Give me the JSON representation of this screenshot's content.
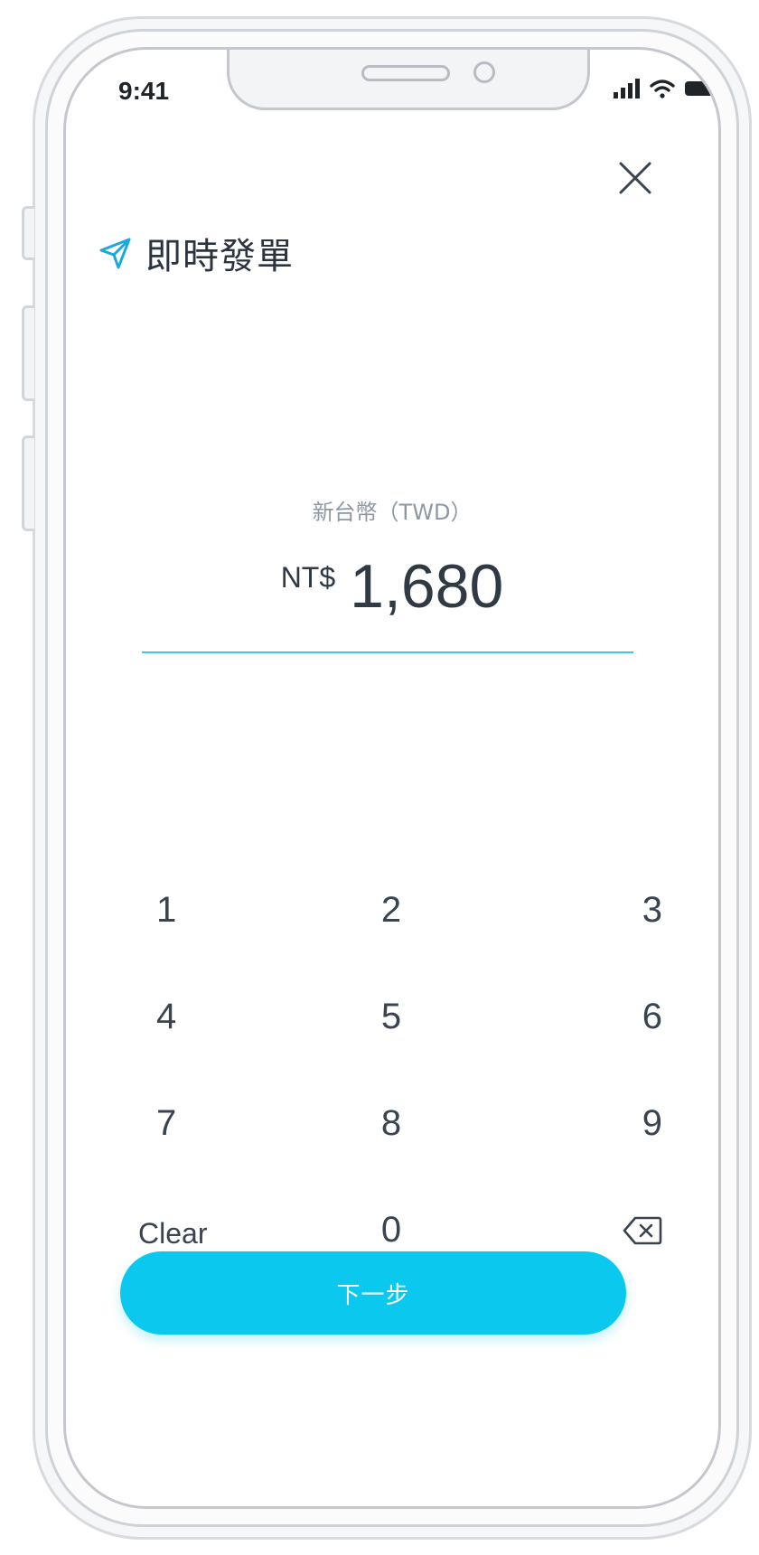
{
  "status_bar": {
    "time": "9:41",
    "signal_icon": "cellular-signal-icon",
    "wifi_icon": "wifi-icon",
    "battery_icon": "battery-icon"
  },
  "header": {
    "close_icon": "close-icon",
    "title_icon": "send-icon",
    "title": "即時發單"
  },
  "amount": {
    "currency_label": "新台幣（TWD）",
    "prefix": "NT$",
    "value": "1,680"
  },
  "keypad": {
    "keys": [
      "1",
      "2",
      "3",
      "4",
      "5",
      "6",
      "7",
      "8",
      "9"
    ],
    "clear_label": "Clear",
    "zero_label": "0",
    "backspace_icon": "backspace-icon"
  },
  "next_button": {
    "label": "下一步"
  },
  "colors": {
    "accent": "#0bc8ef",
    "underline": "#38c8ea",
    "text": "#2f3a45",
    "muted": "#8e98a4"
  }
}
